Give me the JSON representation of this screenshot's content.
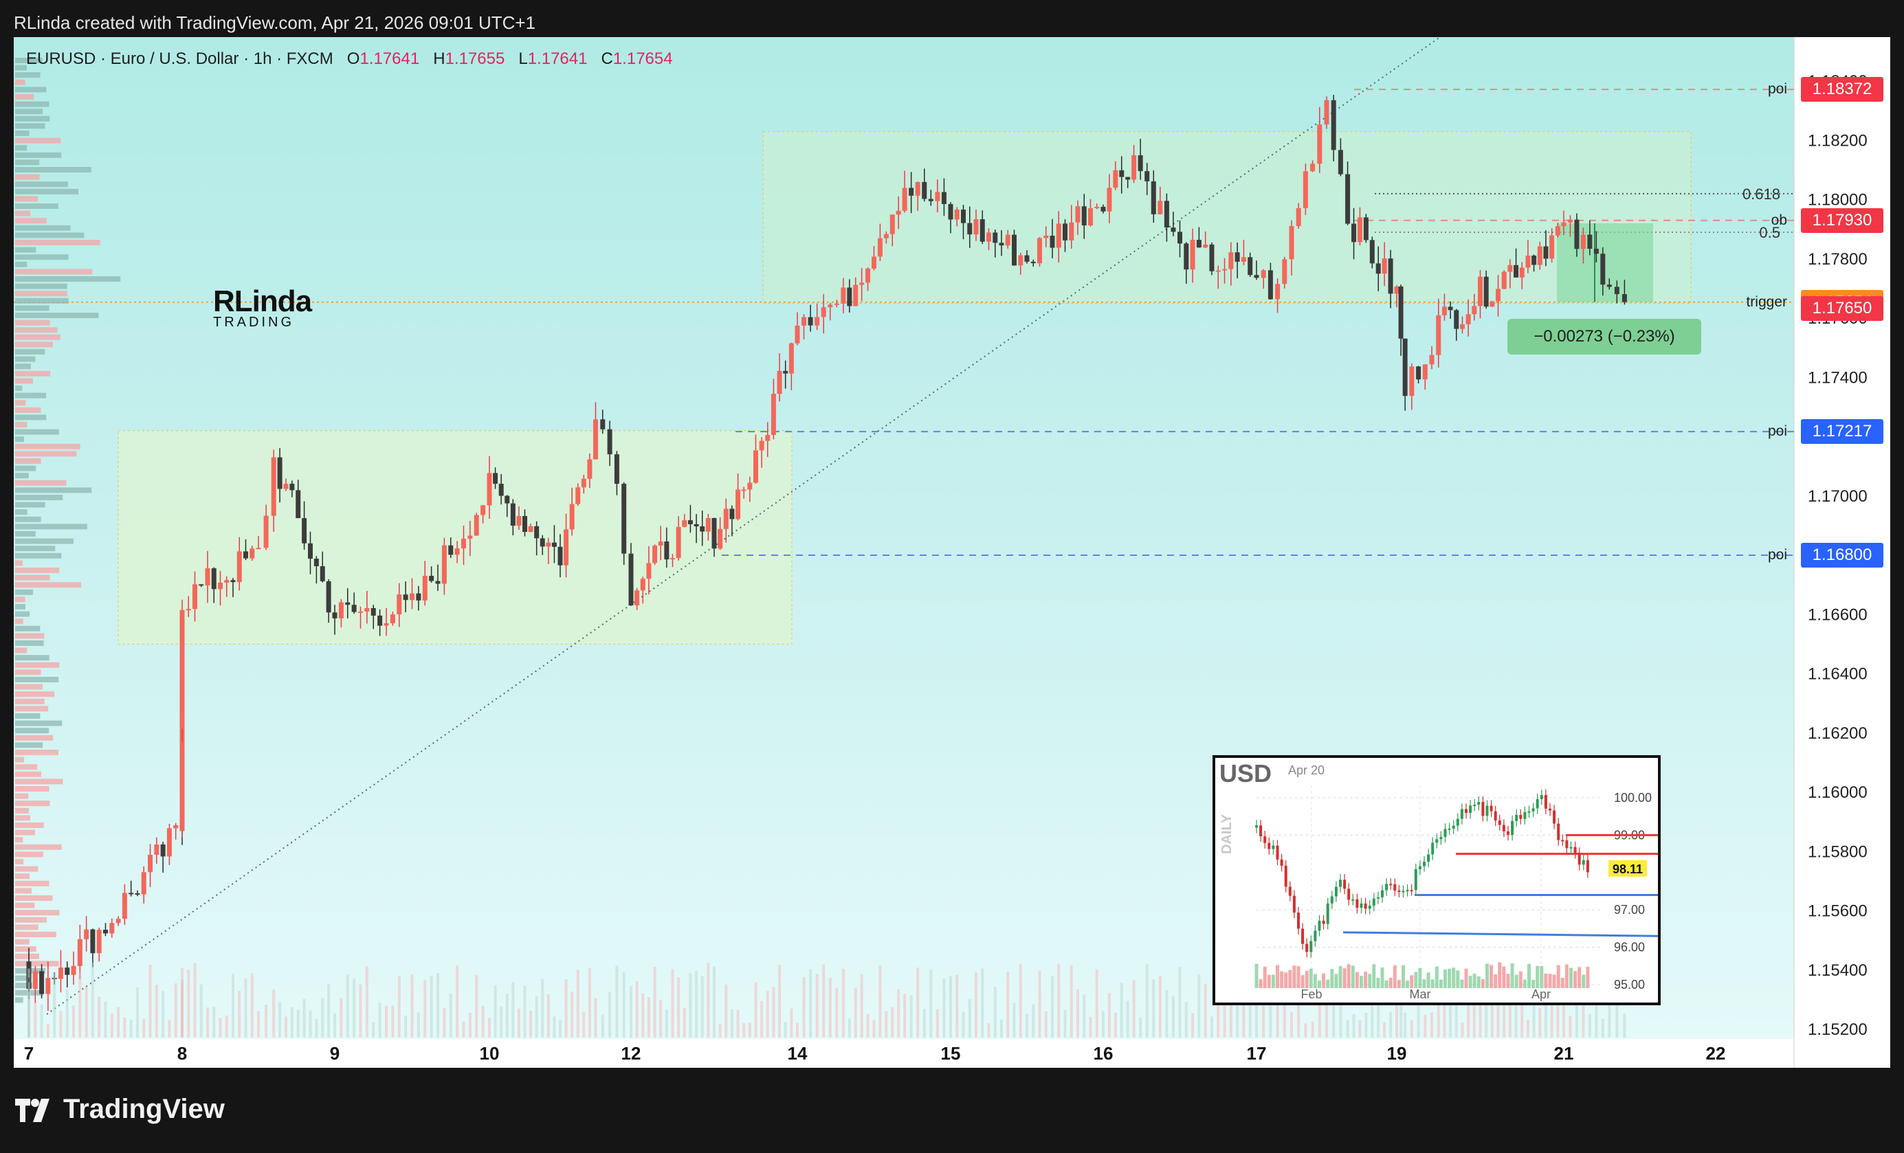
{
  "header": {
    "title": "RLinda created with TradingView.com, Apr 21, 2026 09:01 UTC+1"
  },
  "legend": {
    "symbol": "EURUSD · Euro / U.S. Dollar · 1h · FXCM",
    "o_label": "O",
    "o": "1.17641",
    "h_label": "H",
    "h": "1.17655",
    "l_label": "L",
    "l": "1.17641",
    "c_label": "C",
    "c": "1.17654"
  },
  "brand": {
    "name": "RLinda",
    "sub": "TRADING"
  },
  "footer": {
    "logo_text": "TradingView"
  },
  "delta_box": {
    "text": "−0.00273 (−0.23%)"
  },
  "price_labels": [
    {
      "tag": "poi",
      "price": "1.18372",
      "color": "#f23645"
    },
    {
      "tag": "ob",
      "price": "1.17930",
      "color": "#f23645"
    },
    {
      "tag": "trigger",
      "price": "1.17654",
      "color": "#ff8a1f"
    },
    {
      "tag": "",
      "price": "1.17650",
      "color": "#f23645"
    },
    {
      "tag": "poi",
      "price": "1.17217",
      "color": "#2962ff"
    },
    {
      "tag": "poi",
      "price": "1.16800",
      "color": "#2962ff"
    }
  ],
  "fib_labels": {
    "f618": "0.618",
    "f05": "0.5"
  },
  "chart_data": {
    "type": "candlestick",
    "title": "EURUSD · Euro / U.S. Dollar · 1h · FXCM",
    "y_ticks": [
      "1.18400",
      "1.18200",
      "1.18000",
      "1.17800",
      "1.17600",
      "1.17400",
      "1.17200",
      "1.17000",
      "1.16800",
      "1.16600",
      "1.16400",
      "1.16200",
      "1.16000",
      "1.15800",
      "1.15600",
      "1.15400",
      "1.15200"
    ],
    "ylim": [
      1.1518,
      1.1852
    ],
    "x_ticks": [
      "7",
      "8",
      "9",
      "10",
      "12",
      "14",
      "15",
      "16",
      "17",
      "19",
      "21",
      "22"
    ],
    "grid": false,
    "key_levels": {
      "poi_upper": 1.18372,
      "fib_0618": 1.1802,
      "ob": 1.1793,
      "fib_05": 1.1789,
      "trigger": 1.17654,
      "last": 1.1765,
      "poi_mid": 1.17217,
      "poi_lower": 1.168
    },
    "zones": [
      {
        "name": "upper range",
        "from": 1.1765,
        "to": 1.1823
      },
      {
        "name": "lower range",
        "from": 1.165,
        "to": 1.1722
      }
    ],
    "close_path": [
      {
        "x": "7",
        "close": 1.154
      },
      {
        "x": "7",
        "close": 1.1533
      },
      {
        "x": "7.5",
        "close": 1.1555
      },
      {
        "x": "8",
        "close": 1.1588
      },
      {
        "x": "8",
        "close": 1.1665
      },
      {
        "x": "8.5",
        "close": 1.168
      },
      {
        "x": "8.6",
        "close": 1.1712
      },
      {
        "x": "9",
        "close": 1.166
      },
      {
        "x": "9.5",
        "close": 1.1662
      },
      {
        "x": "10",
        "close": 1.1702
      },
      {
        "x": "10.5",
        "close": 1.1692
      },
      {
        "x": "11",
        "close": 1.168
      },
      {
        "x": "11.5",
        "close": 1.1726
      },
      {
        "x": "11.7",
        "close": 1.172
      },
      {
        "x": "12",
        "close": 1.1668
      },
      {
        "x": "12.5",
        "close": 1.1685
      },
      {
        "x": "13",
        "close": 1.1688
      },
      {
        "x": "13.5",
        "close": 1.171
      },
      {
        "x": "14",
        "close": 1.1762
      },
      {
        "x": "14.3",
        "close": 1.1765
      },
      {
        "x": "14.7",
        "close": 1.1805
      },
      {
        "x": "15",
        "close": 1.1795
      },
      {
        "x": "15.5",
        "close": 1.178
      },
      {
        "x": "16",
        "close": 1.1802
      },
      {
        "x": "16.2",
        "close": 1.1815
      },
      {
        "x": "16.5",
        "close": 1.1782
      },
      {
        "x": "17",
        "close": 1.1775
      },
      {
        "x": "17.3",
        "close": 1.1768
      },
      {
        "x": "17.5",
        "close": 1.179
      },
      {
        "x": "18",
        "close": 1.1835
      },
      {
        "x": "18.3",
        "close": 1.1795
      },
      {
        "x": "19",
        "close": 1.1768
      },
      {
        "x": "19.1",
        "close": 1.1735
      },
      {
        "x": "19.5",
        "close": 1.1758
      },
      {
        "x": "20",
        "close": 1.1768
      },
      {
        "x": "20.5",
        "close": 1.178
      },
      {
        "x": "21",
        "close": 1.179
      },
      {
        "x": "21.3",
        "close": 1.1775
      },
      {
        "x": "21.4",
        "close": 1.17654
      }
    ]
  },
  "inset": {
    "title": "USD",
    "date": "Apr 20",
    "timeframe": "DAILY",
    "y_ticks": [
      "100.00",
      "99.00",
      "97.00",
      "96.00",
      "95.00"
    ],
    "x_ticks": [
      "Feb",
      "Mar",
      "Apr"
    ],
    "last": "98.11"
  }
}
